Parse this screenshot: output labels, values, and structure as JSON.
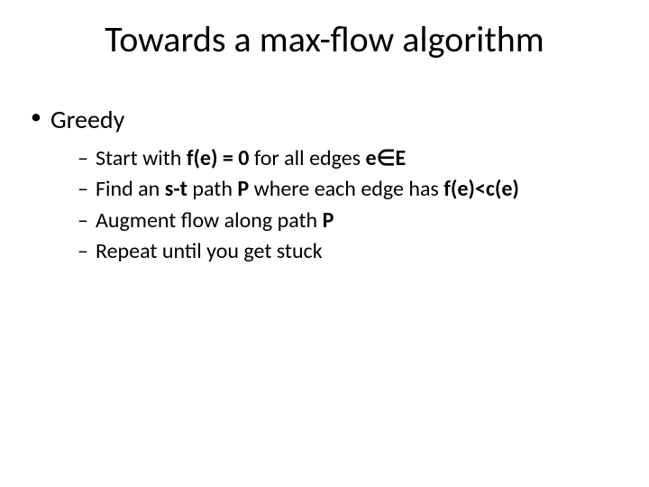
{
  "title": "Towards a max-flow algorithm",
  "bullets": {
    "greedy": {
      "label": "Greedy",
      "items": {
        "i0": {
          "pre": "Start with ",
          "bold": "f(e) = 0",
          "mid": " for all edges ",
          "bold2": "e∈E"
        },
        "i1": {
          "pre": "Find an ",
          "bold": "s-t",
          "mid": " path ",
          "bold2": "P",
          "mid2": " where each edge has ",
          "bold3": "f(e)<c(e)"
        },
        "i2": {
          "pre": "Augment flow along path ",
          "bold": "P"
        },
        "i3": {
          "pre": "Repeat until you get stuck"
        }
      }
    }
  }
}
